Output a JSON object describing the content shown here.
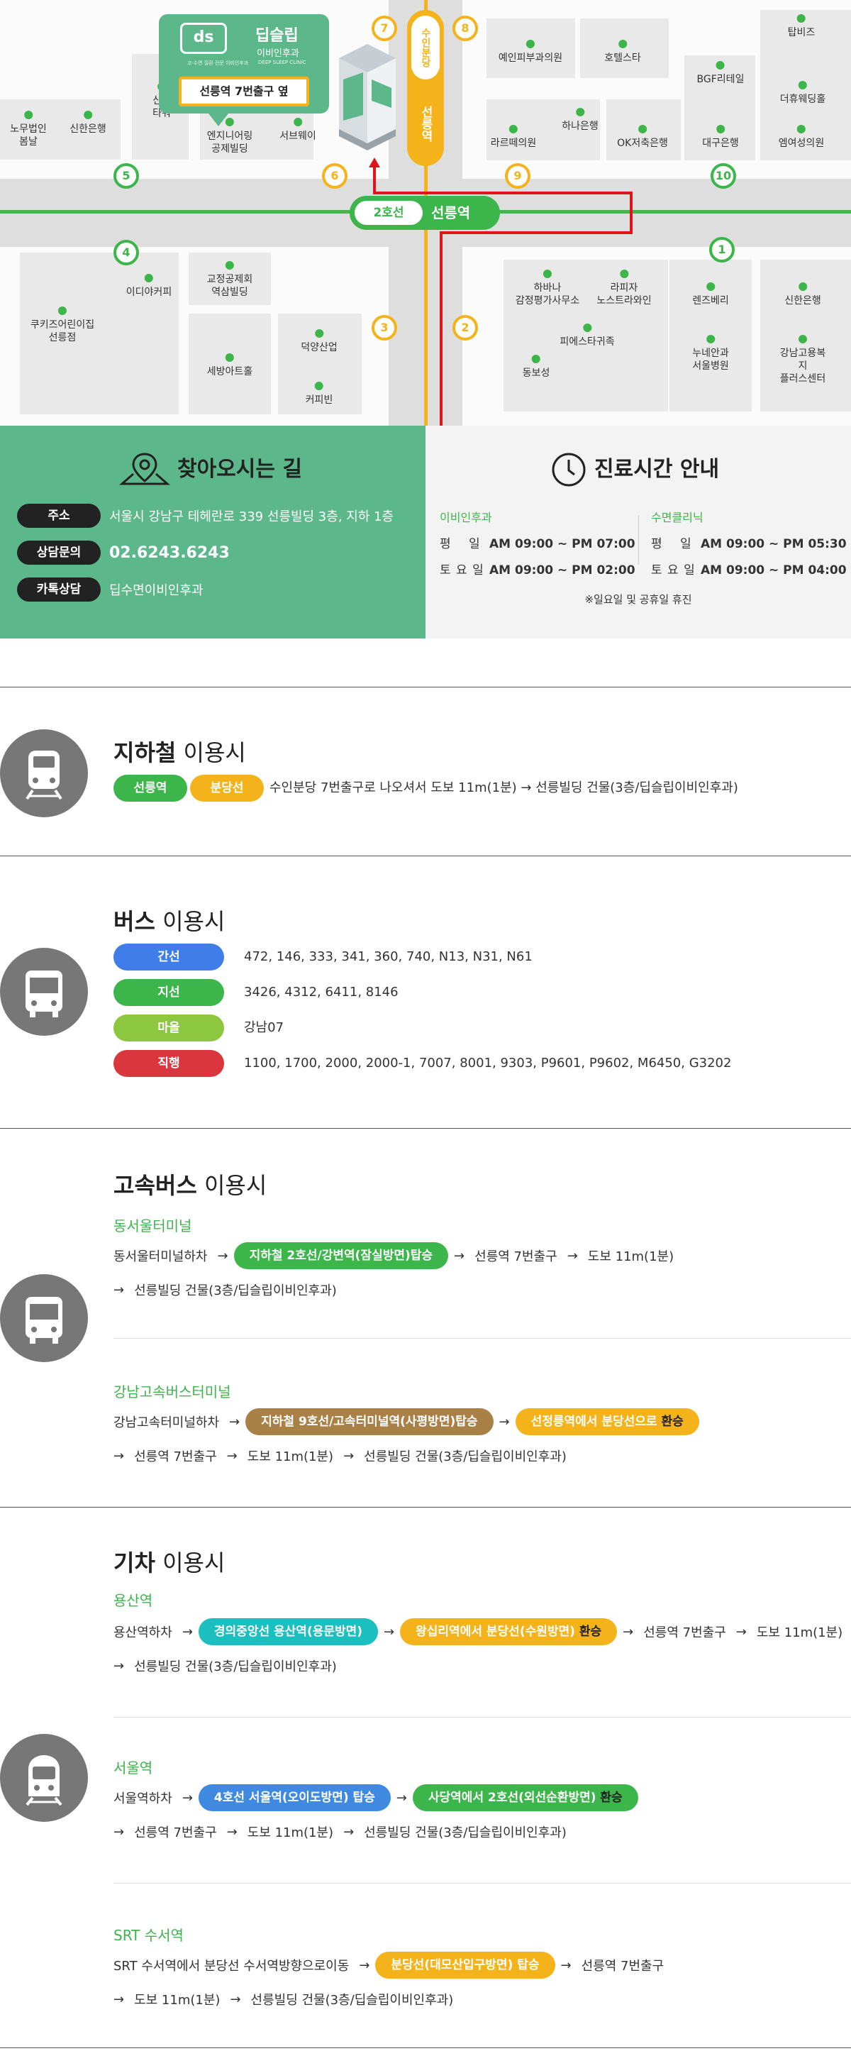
{
  "map": {
    "station": {
      "line": "2호선",
      "name": "선릉역"
    },
    "bundang": {
      "line": "수인분당",
      "name": "선릉역"
    },
    "clinic": {
      "name": "딥슬립",
      "sub": "이비인후과",
      "logo": "ds",
      "tagline": "코·수면 질환 전문 이비인후과",
      "tagline_en": "DEEP SLEEP CLINIC",
      "exit_note": "선릉역 7번출구 옆",
      "building_label": "딥슬립 이비인후과"
    },
    "exits": [
      "1",
      "2",
      "3",
      "4",
      "5",
      "6",
      "7",
      "8",
      "9",
      "10"
    ],
    "pois": {
      "nowon": "노무법인\n봄날",
      "shinhan1": "신한은행",
      "sindo": "신도\n타워",
      "engineering": "엔지니어링\n공제빌딩",
      "subway": "서브웨이",
      "yein": "예인피부과의원",
      "hotel": "호텔스타",
      "topbiz": "탑비즈",
      "bgf": "BGF리테일",
      "wedding": "더휴웨딩홀",
      "larue": "라르떼의원",
      "hana": "하나은행",
      "ok": "OK저축은행",
      "daegu": "대구은행",
      "elm": "엠여성의원",
      "ediya": "이디야커피",
      "gyojung": "교정공제회\n역삼빌딩",
      "cookie": "쿠키즈어린이집\n선릉점",
      "sebang": "세방아트홀",
      "deokyang": "덕양산업",
      "coffee": "커피빈",
      "havana": "하바나\n감정평가사무소",
      "lapiza": "라피자\n노스트라와인",
      "fitness": "피에스타귀족",
      "dongbo": "동보성",
      "lens": "렌즈베리",
      "shinhan2": "신한은행",
      "nunian": "누네안과\n서울병원",
      "gangnam": "강남고용복지\n플러스센터"
    }
  },
  "info": {
    "title": "찾아오시는 길",
    "address_label": "주소",
    "address": "서울시 강남구 테헤란로 339 선릉빌딩 3층, 지하 1층",
    "phone_label": "상담문의",
    "phone": "02.6243.6243",
    "kakao_label": "카톡상담",
    "kakao": "딥수면이비인후과",
    "hours_title": "진료시간 안내",
    "col1": {
      "head": "이비인후과",
      "r1_day": "평 　일",
      "r1": "AM 09:00 ~ PM 07:00",
      "r2_day": "토 요 일",
      "r2": "AM 09:00 ~ PM 02:00"
    },
    "col2": {
      "head": "수면클리닉",
      "r1_day": "평 　일",
      "r1": "AM 09:00 ~ PM 05:30",
      "r2_day": "토 요 일",
      "r2": "AM 09:00 ~ PM 04:00"
    },
    "holiday": "※일요일 및 공휴일 휴진"
  },
  "subway": {
    "title_b": "지하철",
    "title": "이용시",
    "tag1": "선릉역",
    "tag2": "분당선",
    "desc": "수인분당 7번출구로 나오셔서 도보 11m(1분) → 선릉빌딩 건물(3층/딥슬립이비인후과)"
  },
  "bus": {
    "title_b": "버스",
    "title": "이용시",
    "rows": [
      {
        "label": "간선",
        "color": "#3f7ee8",
        "routes": "472, 146, 333, 341, 360, 740, N13, N31, N61"
      },
      {
        "label": "지선",
        "color": "#3cb54a",
        "routes": "3426, 4312, 6411, 8146"
      },
      {
        "label": "마을",
        "color": "#8dc63f",
        "routes": "강남07"
      },
      {
        "label": "직행",
        "color": "#d9363e",
        "routes": "1100, 1700, 2000, 2000-1, 7007, 8001, 9303, P9601, P9602, M6450, G3202"
      }
    ]
  },
  "express": {
    "title_b": "고속버스",
    "title": "이용시",
    "t1": {
      "name": "동서울터미널",
      "s1": "동서울터미널하차",
      "p1": "지하철 2호선/강변역(잠실방면)탑승",
      "s2": "선릉역 7번출구",
      "s3": "도보 11m(1분)",
      "s4": "선릉빌딩 건물(3층/딥슬립이비인후과)"
    },
    "t2": {
      "name": "강남고속버스터미널",
      "s1": "강남고속터미널하차",
      "p1": "지하철 9호선/고속터미널역(사평방면)탑승",
      "p2": "선정릉역에서 분당선으로",
      "p2b": "환승",
      "s2": "선릉역 7번출구",
      "s3": "도보 11m(1분)",
      "s4": "선릉빌딩 건물(3층/딥슬립이비인후과)"
    }
  },
  "train": {
    "title_b": "기차",
    "title": "이용시",
    "t1": {
      "name": "용산역",
      "s1": "용산역하차",
      "p1": "경의중앙선 용산역(용문방면)",
      "p2": "왕십리역에서 분당선(수원방면)",
      "p2b": "환승",
      "s2": "선릉역 7번출구",
      "s3": "도보 11m(1분)",
      "s4": "선릉빌딩 건물(3층/딥슬립이비인후과)"
    },
    "t2": {
      "name": "서울역",
      "s1": "서울역하차",
      "p1": "4호선 서울역(오이도방면) 탑승",
      "p2": "사당역에서 2호선(외선순환방면)",
      "p2b": "환승",
      "s2": "선릉역 7번출구",
      "s3": "도보 11m(1분)",
      "s4": "선릉빌딩 건물(3층/딥슬립이비인후과)"
    },
    "t3": {
      "name": "SRT 수서역",
      "s1": "SRT 수서역에서 분당선 수서역방향으로이동",
      "p1": "분당선(대모산입구방면) 탑승",
      "s2": "선릉역 7번출구",
      "s3": "도보 11m(1분)",
      "s4": "선릉빌딩 건물(3층/딥슬립이비인후과)"
    }
  },
  "colors": {
    "green": "#3cb54a",
    "mint": "#5cb88a",
    "yellow": "#f5b31b",
    "red": "#e0141b",
    "gray_icon": "#777777"
  }
}
